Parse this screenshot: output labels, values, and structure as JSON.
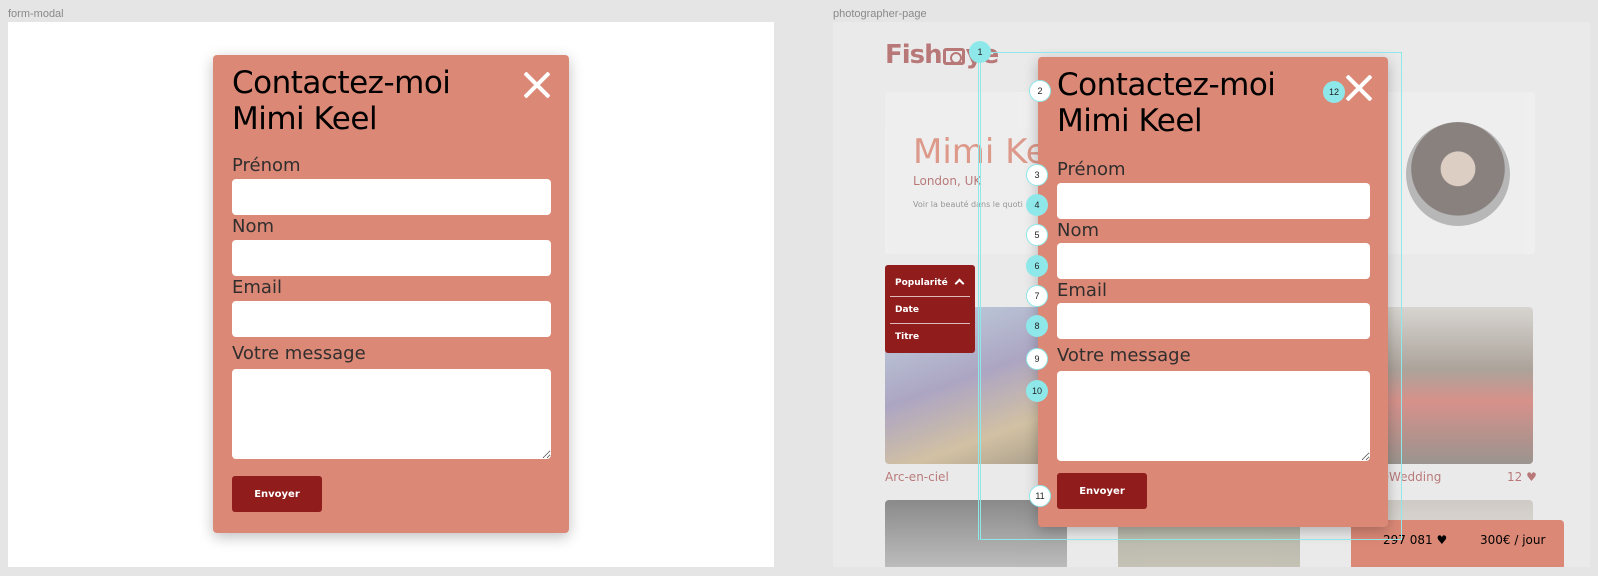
{
  "frames": {
    "left_label": "form-modal",
    "right_label": "photographer-page"
  },
  "modal": {
    "title_line1": "Contactez-moi",
    "title_line2": "Mimi Keel",
    "fields": [
      {
        "label": "Prénom",
        "value": ""
      },
      {
        "label": "Nom",
        "value": ""
      },
      {
        "label": "Email",
        "value": ""
      },
      {
        "label": "Votre message",
        "value": ""
      }
    ],
    "submit_label": "Envoyer",
    "icons": {
      "close": "close-icon"
    }
  },
  "page": {
    "logo_text_start": "Fish",
    "logo_text_end": "ye",
    "photographer": {
      "name": "Mimi Ke",
      "location": "London, UK",
      "tagline": "Voir la beauté dans le quoti"
    },
    "sort": {
      "options": [
        "Popularité",
        "Date",
        "Titre"
      ]
    },
    "photos": [
      {
        "title": "Arc-en-ciel"
      },
      {
        "title": "deWedding",
        "likes": "12 ♥"
      }
    ],
    "price_bar": {
      "likes": "297 081 ♥",
      "rate": "300€ / jour"
    }
  },
  "annotations": [
    "1",
    "2",
    "3",
    "4",
    "5",
    "6",
    "7",
    "8",
    "9",
    "10",
    "11",
    "12"
  ],
  "colors": {
    "modal_bg": "#db8876",
    "primary": "#901c1c",
    "accent_guide": "#8ee8ea"
  }
}
